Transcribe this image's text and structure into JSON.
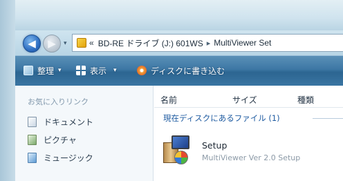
{
  "address_bar": {
    "overflow_chevron": "«",
    "segments": [
      "BD-RE ドライブ (J:) 601WS",
      "MultiViewer Set"
    ],
    "separator": "▸"
  },
  "nav_buttons": {
    "back_icon": "arrow-left-icon",
    "forward_icon": "arrow-right-icon",
    "dropdown": "▾"
  },
  "toolbar": {
    "organize_label": "整理",
    "views_label": "表示",
    "burn_label": "ディスクに書き込む",
    "dropdown": "▾"
  },
  "nav_pane": {
    "title": "お気に入りリンク",
    "items": [
      {
        "label": "ドキュメント",
        "icon": "documents-icon"
      },
      {
        "label": "ピクチャ",
        "icon": "pictures-icon"
      },
      {
        "label": "ミュージック",
        "icon": "music-icon"
      }
    ]
  },
  "file_list": {
    "columns": [
      "名前",
      "サイズ",
      "種類"
    ],
    "group_header": "現在ディスクにあるファイル (1)",
    "files": [
      {
        "name": "Setup",
        "description": "MultiViewer Ver 2.0 Setup",
        "icon": "setup-installer-icon"
      }
    ]
  },
  "colors": {
    "toolbar": "#3d77a4",
    "group_header": "#1d5aa0",
    "nav_back": "#2f6fc3"
  }
}
